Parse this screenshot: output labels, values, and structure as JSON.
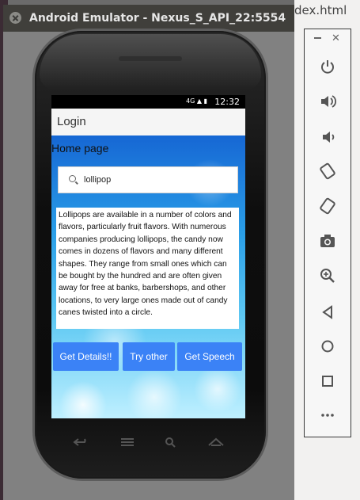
{
  "editor": {
    "tab_text": "dex.html"
  },
  "window": {
    "title": "Android Emulator - Nexus_S_API_22:5554"
  },
  "statusbar": {
    "signal": "4G",
    "time": "12:32"
  },
  "app": {
    "appbar_title": "Login",
    "home_title": "Home page",
    "search": {
      "value": "lollipop",
      "icon": "search-icon"
    },
    "description": "Lollipops are available in a number of colors and flavors, particularly fruit flavors. With numerous companies producing lollipops, the candy now comes in dozens of flavors and many different shapes. They range from small ones which can be bought by the hundred and are often given away for free at banks, barbershops, and other locations, to very large ones made out of candy canes twisted into a circle.",
    "buttons": {
      "get_details": "Get Details!!",
      "try_other": "Try other",
      "get_speech": "Get Speech"
    },
    "accent_color": "#3b82f6"
  },
  "navbar": {
    "icons": [
      "back-icon",
      "home-icon",
      "search-icon",
      "menu-up-icon"
    ]
  },
  "toolbar": {
    "icons": [
      "power-icon",
      "volume-up-icon",
      "volume-down-icon",
      "rotate-left-icon",
      "rotate-right-icon",
      "camera-icon",
      "zoom-icon",
      "back-icon",
      "home-icon",
      "overview-icon",
      "more-icon"
    ]
  }
}
